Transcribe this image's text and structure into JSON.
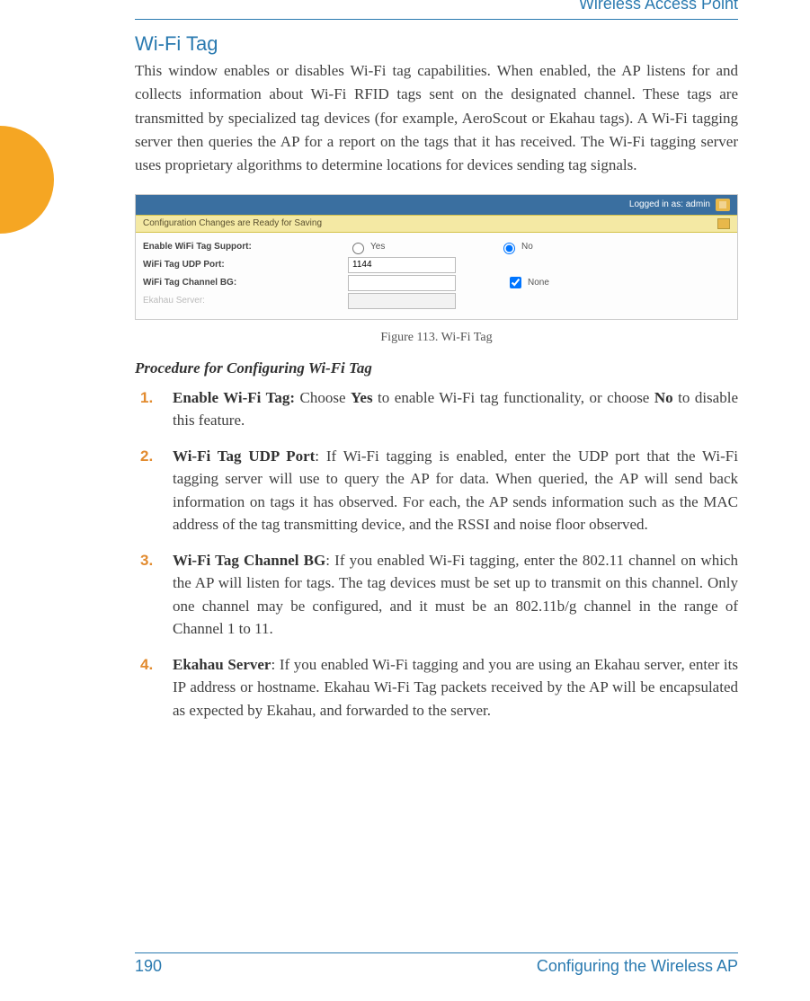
{
  "header": {
    "doc_title": "Wireless Access Point"
  },
  "section": {
    "title": "Wi-Fi Tag"
  },
  "intro": "This window enables or disables Wi-Fi tag capabilities. When enabled, the AP listens for and collects information about Wi-Fi RFID tags sent on the designated channel. These tags are transmitted by specialized tag devices (for example, AeroScout or Ekahau tags). A Wi-Fi tagging server then queries the AP for a report on the tags that it has received. The Wi-Fi tagging server uses proprietary algorithms to determine locations for devices sending tag signals.",
  "figure": {
    "login_text": "Logged in as: admin",
    "save_bar_text": "Configuration Changes are Ready for Saving",
    "rows": {
      "enable_label": "Enable WiFi Tag Support:",
      "yes": "Yes",
      "no": "No",
      "udp_label": "WiFi Tag UDP Port:",
      "udp_value": "1144",
      "channel_label": "WiFi Tag Channel BG:",
      "channel_value": "",
      "none": "None",
      "ekahau_label": "Ekahau Server:",
      "ekahau_value": ""
    },
    "caption": "Figure 113. Wi-Fi Tag"
  },
  "procedure": {
    "title": "Procedure for Configuring Wi-Fi Tag",
    "step1_bold": "Enable Wi-Fi Tag:",
    "step1_a": " Choose ",
    "step1_yes": "Yes",
    "step1_b": " to enable Wi-Fi tag functionality, or choose ",
    "step1_no": "No",
    "step1_c": " to disable this feature.",
    "step2_bold": "Wi-Fi Tag UDP Port",
    "step2_text": ": If Wi-Fi tagging is enabled, enter the UDP port that the Wi-Fi tagging server will use to query the AP for data. When queried, the AP will send back information on tags it has observed. For each, the AP sends information such as the MAC address of the tag transmitting device, and the RSSI and noise floor observed.",
    "step3_bold": "Wi-Fi Tag Channel BG",
    "step3_text": ": If you enabled Wi-Fi tagging, enter the 802.11 channel on which the AP will listen for tags. The tag devices must be set up to transmit on this channel. Only one channel may be configured, and it must be an 802.11b/g channel in the range of Channel 1 to 11.",
    "step4_bold": "Ekahau Server",
    "step4_text": ": If you enabled Wi-Fi tagging and you are using an Ekahau server, enter its IP address or hostname. Ekahau Wi-Fi Tag packets received by the AP will be encapsulated as expected by Ekahau, and forwarded to the server."
  },
  "footer": {
    "page_number": "190",
    "chapter": "Configuring the Wireless AP"
  }
}
